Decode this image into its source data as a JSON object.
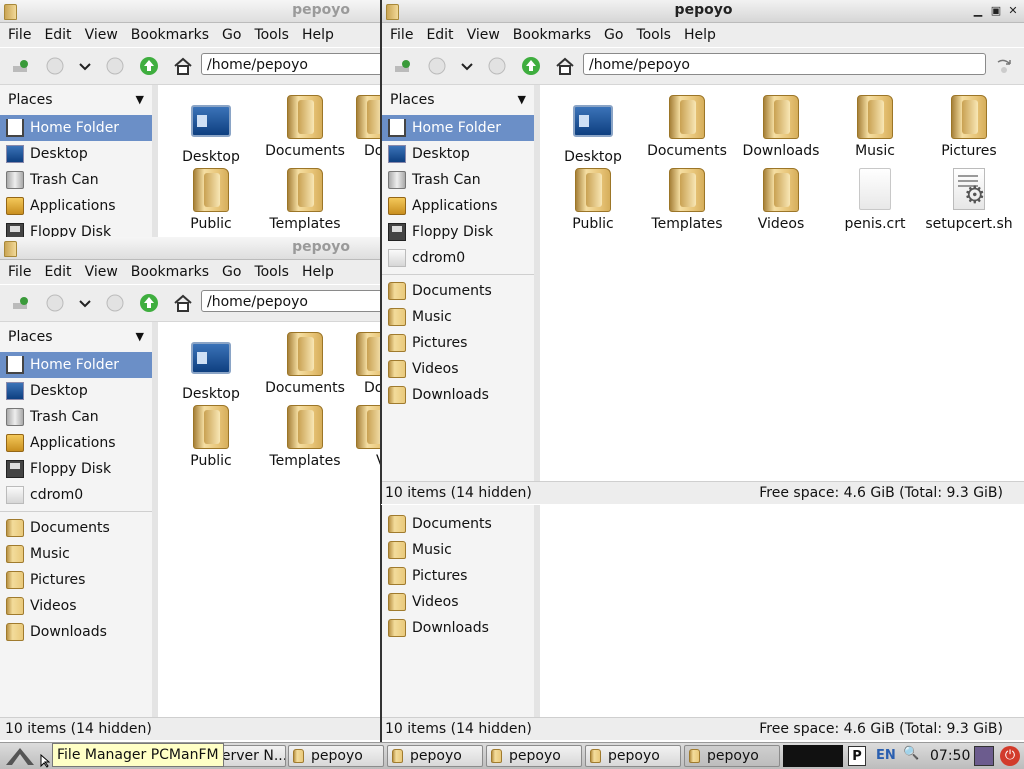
{
  "window_title": "pepoyo",
  "menu": [
    "File",
    "Edit",
    "View",
    "Bookmarks",
    "Go",
    "Tools",
    "Help"
  ],
  "address": "/home/pepoyo",
  "places_header": "Places",
  "places": {
    "home": "Home Folder",
    "desktop": "Desktop",
    "trash": "Trash Can",
    "apps": "Applications",
    "floppy": "Floppy Disk",
    "cdrom": "cdrom0"
  },
  "bookmarks": [
    "Documents",
    "Music",
    "Pictures",
    "Videos",
    "Downloads"
  ],
  "files": {
    "desktop": "Desktop",
    "documents": "Documents",
    "downloads": "Downloads",
    "music": "Music",
    "pictures": "Pictures",
    "public": "Public",
    "templates": "Templates",
    "videos": "Videos",
    "cert": "penis.crt",
    "script": "setupcert.sh",
    "doc_partial": "Do",
    "v_partial": "V"
  },
  "status": {
    "items": "10 items (14 hidden)",
    "free": "Free space: 4.6 GiB (Total: 9.3 GiB)"
  },
  "taskbar": {
    "partial_task": "Server N...",
    "tasks": [
      "pepoyo",
      "pepoyo",
      "pepoyo",
      "pepoyo",
      "pepoyo"
    ],
    "tooltip": "File Manager PCManFM",
    "lang": "EN",
    "clock": "07:50"
  },
  "colors": {
    "selection": "#6b8fc7",
    "tooltip": "#ffffc6"
  }
}
